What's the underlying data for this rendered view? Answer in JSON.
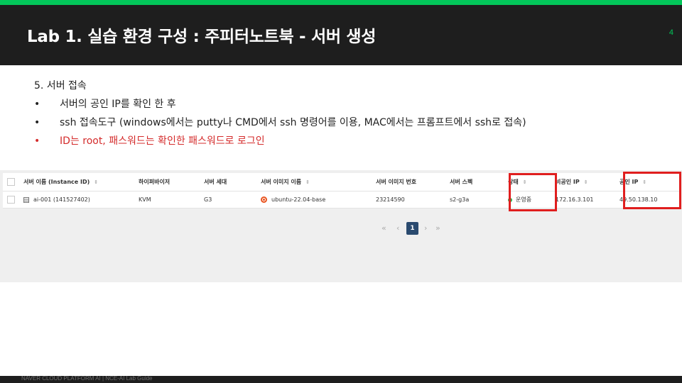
{
  "header": {
    "title": "Lab 1. 실습 환경 구성 : 주피터노트북 - 서버 생성",
    "page_number": "4"
  },
  "content": {
    "step": "5. 서버 접속",
    "bullets": [
      {
        "marker": "•",
        "text": "서버의 공인 IP를 확인 한 후",
        "color": "#222222"
      },
      {
        "marker": "•",
        "text": "ssh 접속도구 (windows에서는 putty나 CMD에서 ssh 명령어를 이용, MAC에서는 프롬프트에서 ssh로 접속)",
        "color": "#222222"
      },
      {
        "marker": "•",
        "text": "ID는 root, 패스워드는 확인한 패스워드로 로그인",
        "color": "#d42b2b"
      }
    ]
  },
  "table": {
    "columns": {
      "name": "서버 이름 (Instance ID)",
      "hypervisor": "하이퍼바이저",
      "generation": "서버 세대",
      "image_name": "서버 이미지 이름",
      "image_number": "서버 이미지 번호",
      "spec": "서버 스펙",
      "status": "상태",
      "private_ip": "비공인 IP",
      "public_ip": "공인 IP"
    },
    "row": {
      "name": "ai-001 (141527402)",
      "hypervisor": "KVM",
      "generation": "G3",
      "image_name": "ubuntu-22.04-base",
      "image_number": "23214590",
      "spec": "s2-g3a",
      "status": "운영중",
      "private_ip": "172.16.3.101",
      "public_ip": "49.50.138.10"
    }
  },
  "pagination": {
    "first": "«",
    "prev": "‹",
    "current": "1",
    "next": "›",
    "last": "»"
  },
  "footer": {
    "text": "NAVER CLOUD PLATFORM AI  |  NCE-AI Lab Guide"
  },
  "colors": {
    "accent": "#03c75a",
    "highlight": "#e01e1e",
    "status_running": "#2fb04f"
  }
}
